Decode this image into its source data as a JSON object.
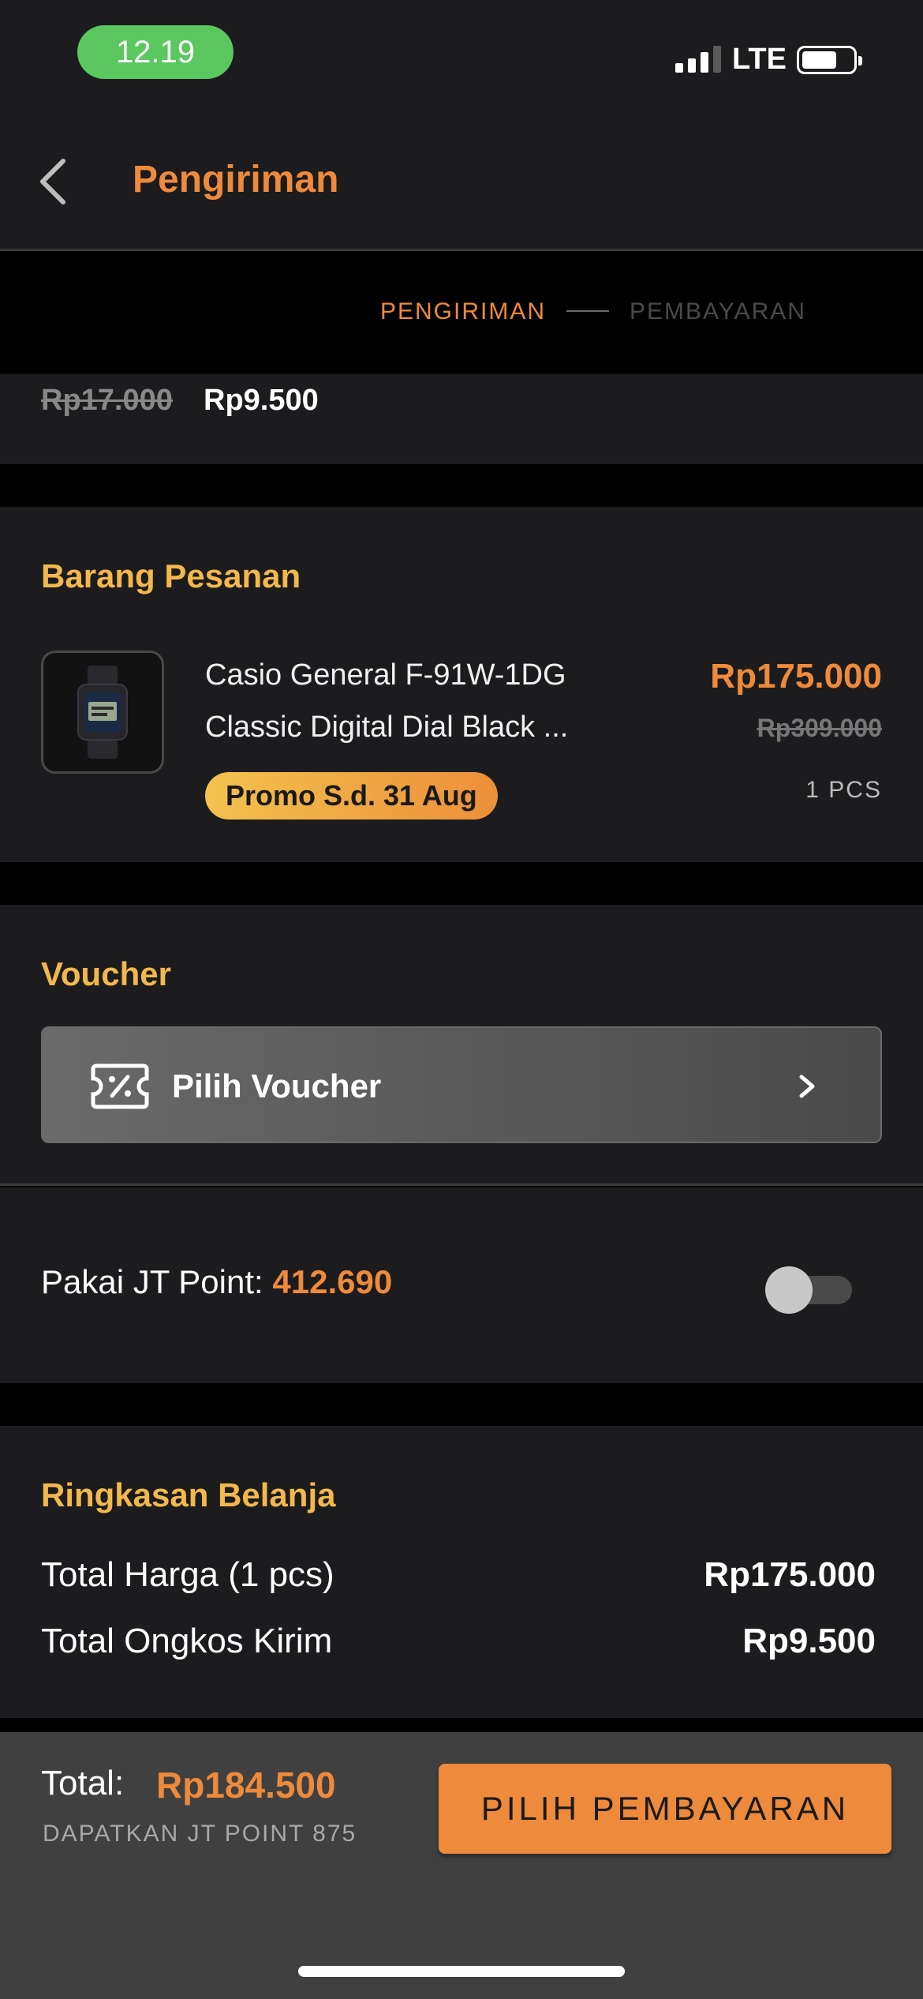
{
  "status_bar": {
    "time": "12.19",
    "network": "LTE"
  },
  "header": {
    "title": "Pengiriman",
    "back_icon": "chevron-left-icon"
  },
  "steps": {
    "current": "PENGIRIMAN",
    "next": "PEMBAYARAN"
  },
  "shipping": {
    "old_price": "Rp17.000",
    "new_price": "Rp9.500"
  },
  "items": {
    "title": "Barang Pesanan",
    "product": {
      "name_line1": "Casio General F-91W-1DG",
      "name_line2": "Classic Digital Dial Black ...",
      "promo": "Promo S.d. 31 Aug",
      "price": "Rp175.000",
      "old_price": "Rp309.000",
      "qty": "1 PCS"
    }
  },
  "voucher": {
    "title": "Voucher",
    "button_label": "Pilih Voucher",
    "icon": "discount-ticket-icon"
  },
  "jt_point": {
    "label": "Pakai JT Point:",
    "value": "412.690",
    "enabled": false
  },
  "summary": {
    "title": "Ringkasan Belanja",
    "rows": [
      {
        "label": "Total Harga (1 pcs)",
        "value": "Rp175.000"
      },
      {
        "label": "Total Ongkos Kirim",
        "value": "Rp9.500"
      }
    ]
  },
  "footer": {
    "total_label": "Total:",
    "total_value": "Rp184.500",
    "earn_text": "DAPATKAN JT POINT 875",
    "pay_button": "PILIH PEMBAYARAN"
  },
  "colors": {
    "accent": "#ee8a3b",
    "section_title": "#f2b84b",
    "card_bg": "#1c1c1e"
  }
}
